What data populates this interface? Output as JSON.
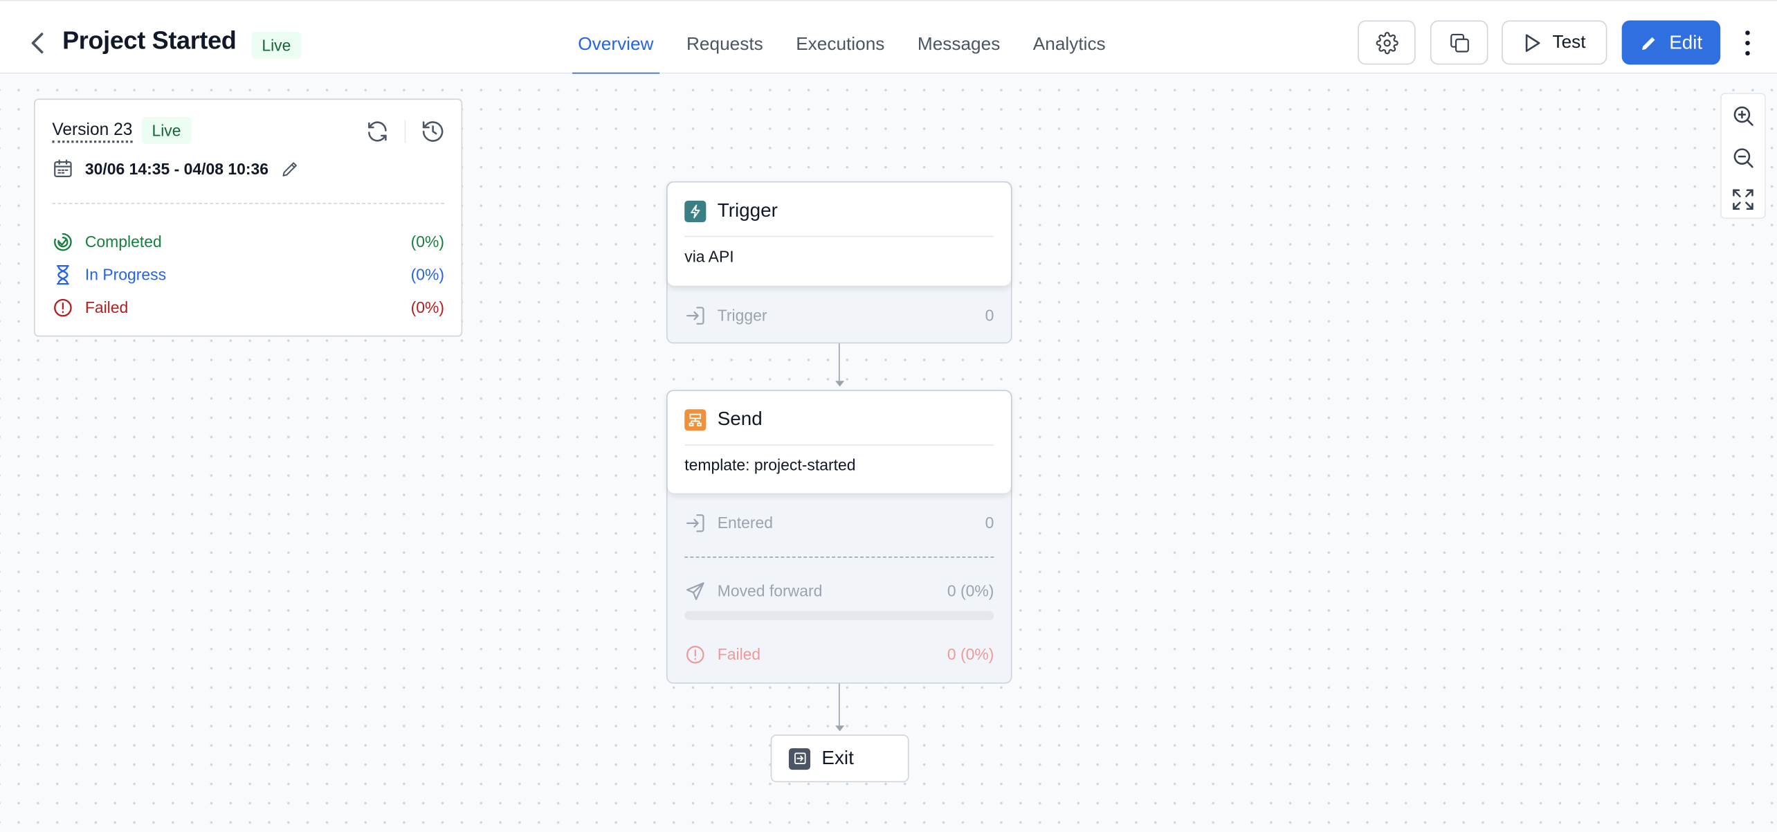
{
  "header": {
    "title": "Project Started",
    "status_badge": "Live",
    "tabs": [
      {
        "label": "Overview",
        "active": true
      },
      {
        "label": "Requests",
        "active": false
      },
      {
        "label": "Executions",
        "active": false
      },
      {
        "label": "Messages",
        "active": false
      },
      {
        "label": "Analytics",
        "active": false
      }
    ],
    "test_label": "Test",
    "edit_label": "Edit",
    "accent_color": "#2f6fe0"
  },
  "version_card": {
    "version_label": "Version 23",
    "status_badge": "Live",
    "date_range": "30/06 14:35 - 04/08 10:36",
    "stats": [
      {
        "label": "Completed",
        "value": "(0%)",
        "color": "#15803d"
      },
      {
        "label": "In Progress",
        "value": "(0%)",
        "color": "#2563eb"
      },
      {
        "label": "Failed",
        "value": "(0%)",
        "color": "#b91c1c"
      }
    ]
  },
  "flow": {
    "trigger": {
      "title": "Trigger",
      "subtitle": "via API",
      "icon": "lightning-icon",
      "icon_color": "#3b7f86",
      "row_label": "Trigger",
      "row_value": "0"
    },
    "send": {
      "title": "Send",
      "subtitle": "template: project-started",
      "icon": "template-icon",
      "icon_color": "#f0913a",
      "entered_label": "Entered",
      "entered_value": "0",
      "moved_label": "Moved forward",
      "moved_value": "0 (0%)",
      "moved_progress": 0,
      "failed_label": "Failed",
      "failed_value": "0 (0%)"
    },
    "exit": {
      "title": "Exit",
      "icon": "exit-icon"
    }
  }
}
